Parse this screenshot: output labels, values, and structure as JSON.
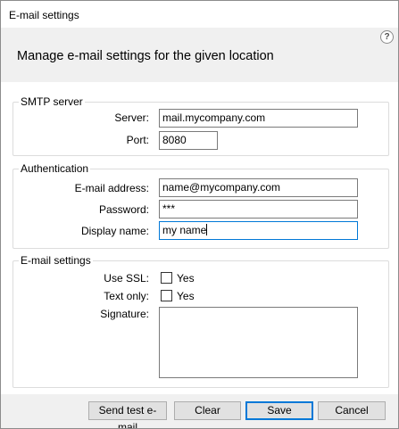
{
  "window": {
    "title": "E-mail settings"
  },
  "header": {
    "title": "Manage e-mail settings for the given location",
    "help": "?"
  },
  "smtp": {
    "legend": "SMTP server",
    "server_label": "Server:",
    "server_value": "mail.mycompany.com",
    "port_label": "Port:",
    "port_value": "8080"
  },
  "auth": {
    "legend": "Authentication",
    "email_label": "E-mail address:",
    "email_value": "name@mycompany.com",
    "password_label": "Password:",
    "password_value": "***",
    "display_label": "Display name:",
    "display_value": "my name"
  },
  "settings": {
    "legend": "E-mail settings",
    "ssl_label": "Use SSL:",
    "ssl_option": "Yes",
    "ssl_checked": false,
    "text_only_label": "Text only:",
    "text_only_option": "Yes",
    "text_only_checked": false,
    "signature_label": "Signature:",
    "signature_value": ""
  },
  "buttons": {
    "send_test": "Send test e-mail",
    "clear": "Clear",
    "save": "Save",
    "cancel": "Cancel"
  }
}
